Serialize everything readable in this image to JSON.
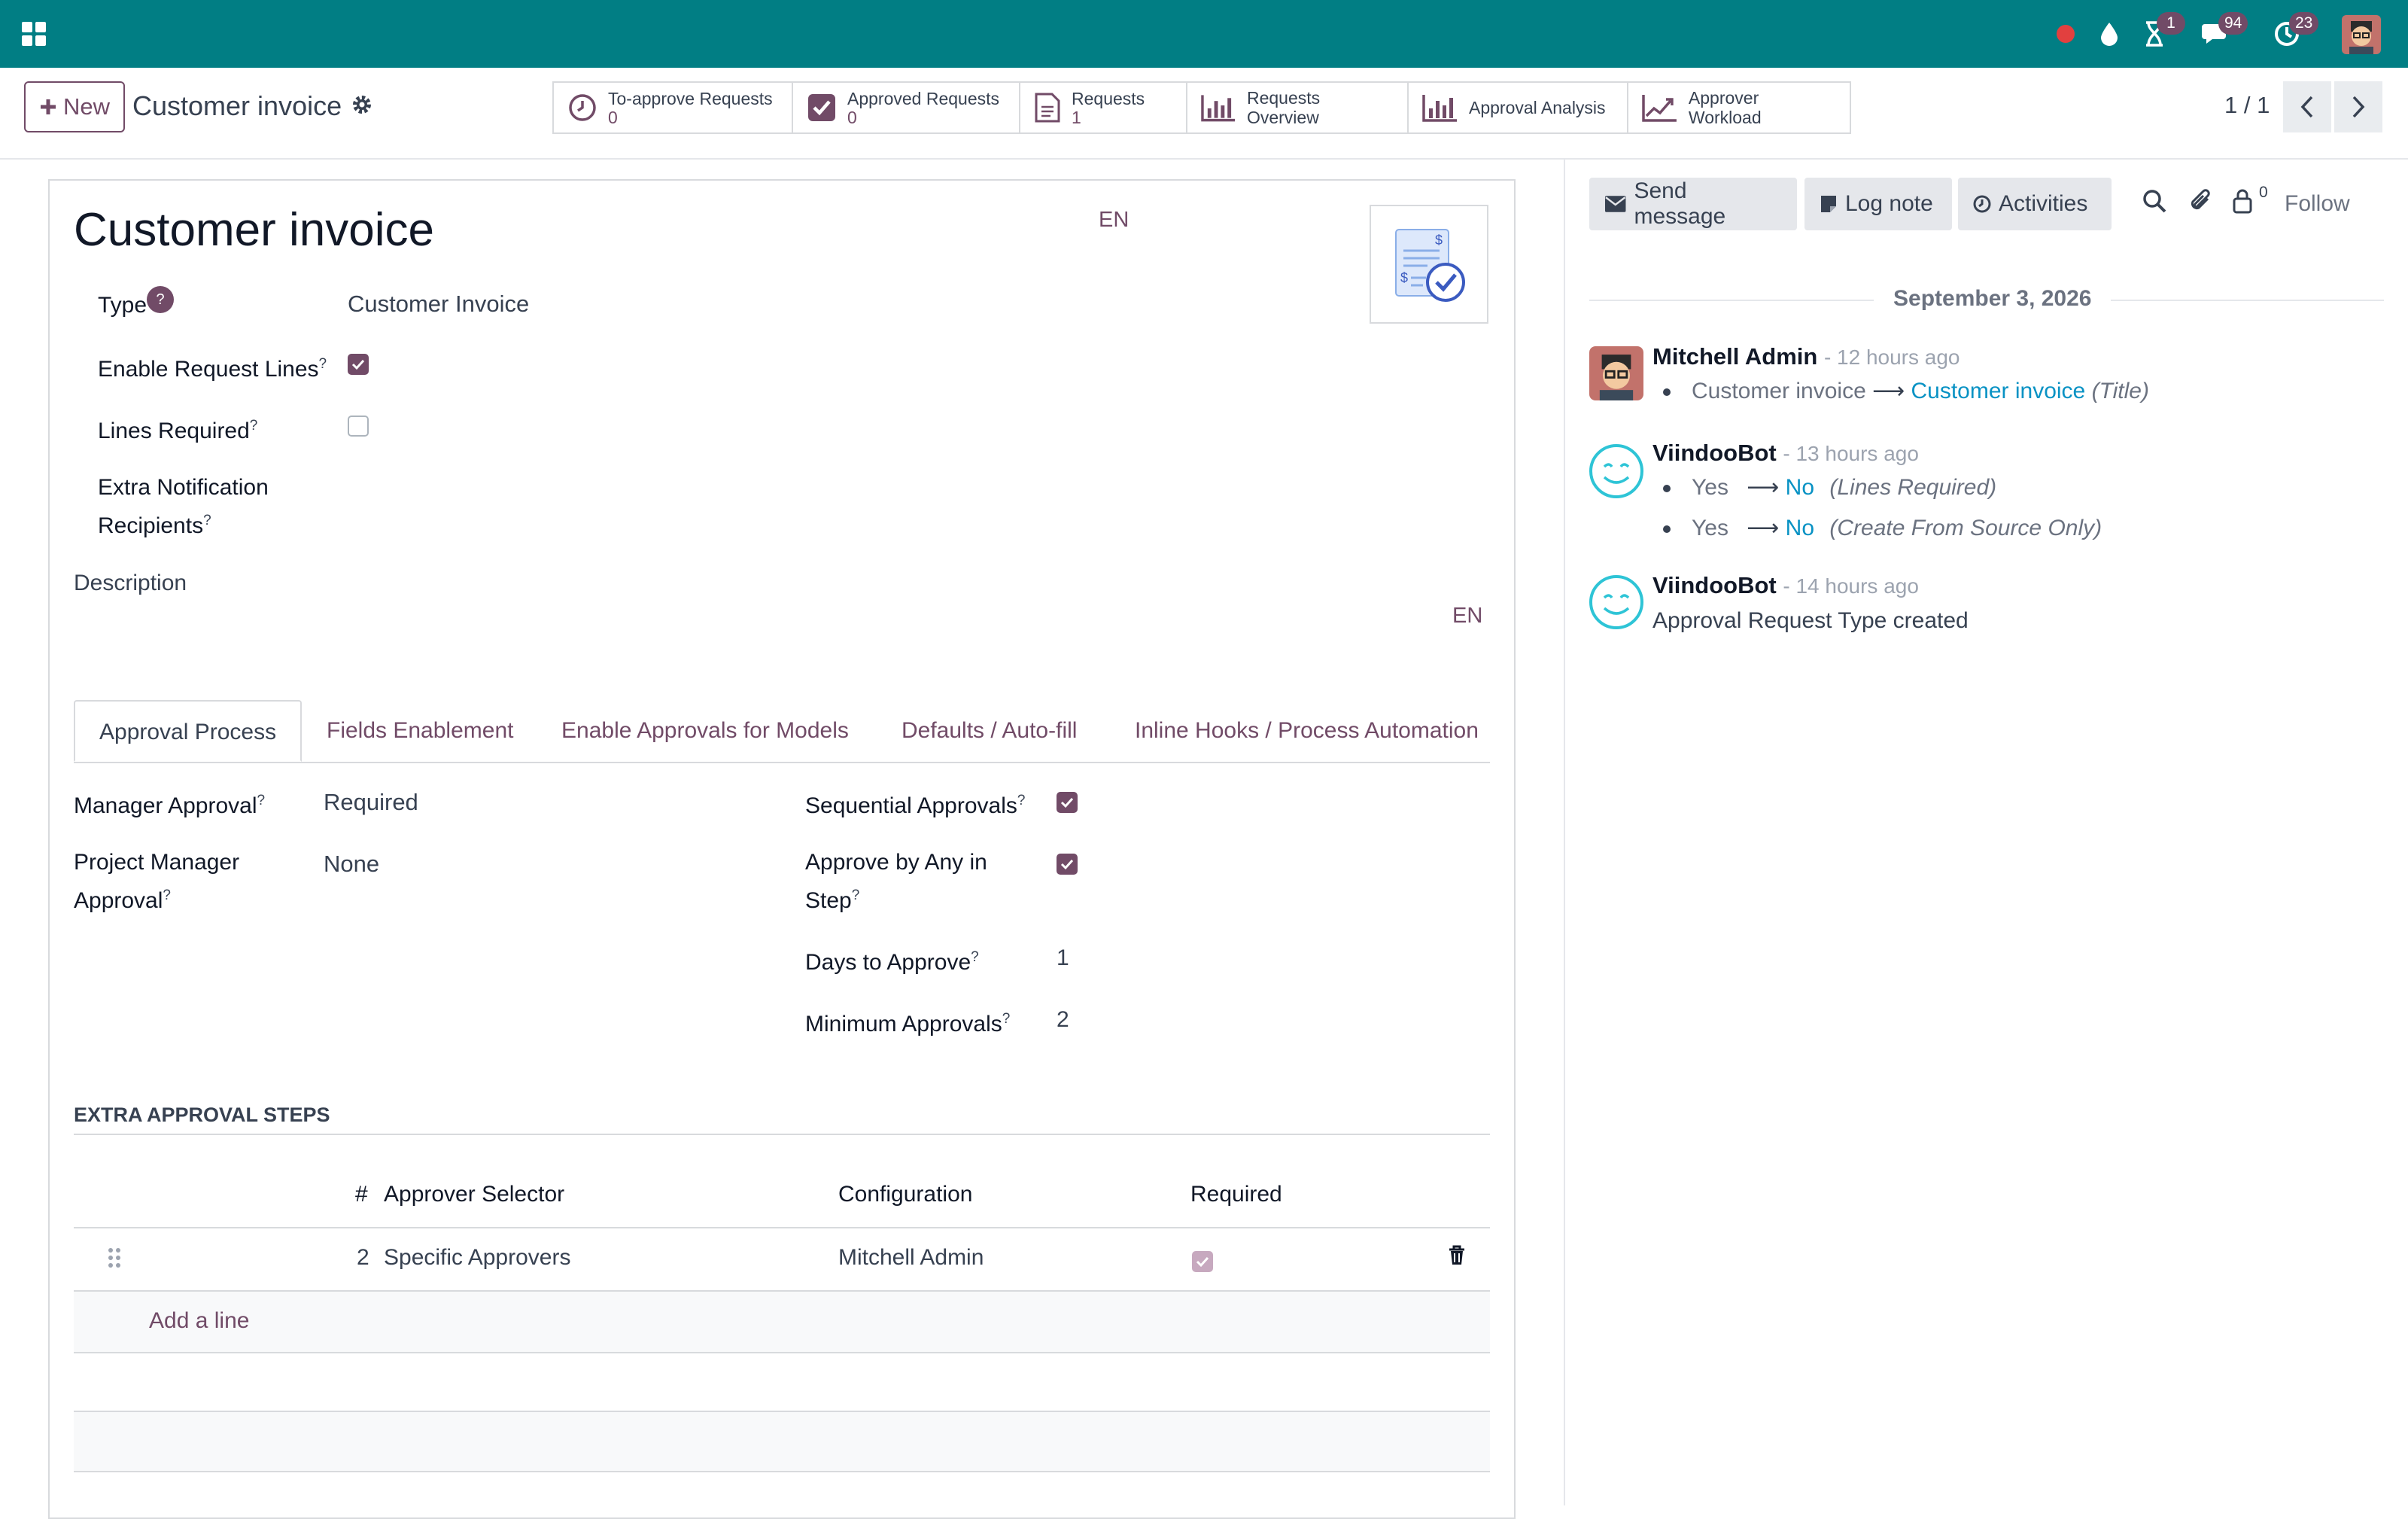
{
  "navbar": {
    "notifications": {
      "activity_count": "1",
      "messages_count": "94",
      "updates_count": "23"
    }
  },
  "control": {
    "new_label": "New",
    "breadcrumb": "Customer invoice",
    "smart_buttons": [
      {
        "label": "To-approve Requests",
        "count": "0",
        "icon": "clock-icon"
      },
      {
        "label": "Approved Requests",
        "count": "0",
        "icon": "check-square-icon"
      },
      {
        "label": "Requests",
        "count": "1",
        "icon": "document-icon"
      },
      {
        "label": "Requests Overview",
        "icon": "bar-chart-icon"
      },
      {
        "label": "Approval Analysis",
        "icon": "bar-chart-icon"
      },
      {
        "label": "Approver Workload",
        "icon": "line-chart-icon"
      }
    ],
    "pager": "1 / 1"
  },
  "form": {
    "title": "Customer invoice",
    "lang_title": "EN",
    "lang_description": "EN",
    "fields": {
      "type_label": "Type",
      "type_help": "?",
      "type_value": "Customer Invoice",
      "enable_lines_label": "Enable Request Lines",
      "enable_lines_value": true,
      "lines_required_label": "Lines Required",
      "lines_required_value": false,
      "extra_notif_label_1": "Extra Notification",
      "extra_notif_label_2": "Recipients",
      "description_label": "Description"
    },
    "tabs": [
      {
        "label": "Approval Process",
        "active": true
      },
      {
        "label": "Fields Enablement"
      },
      {
        "label": "Enable Approvals for Models"
      },
      {
        "label": "Defaults / Auto-fill"
      },
      {
        "label": "Inline Hooks / Process Automation"
      }
    ],
    "approval": {
      "manager_label": "Manager Approval",
      "manager_value": "Required",
      "pm_label_1": "Project Manager",
      "pm_label_2": "Approval",
      "pm_value": "None",
      "sequential_label": "Sequential Approvals",
      "sequential_value": true,
      "any_label_1": "Approve by Any in",
      "any_label_2": "Step",
      "any_value": true,
      "days_label": "Days to Approve",
      "days_value": "1",
      "min_label": "Minimum Approvals",
      "min_value": "2"
    },
    "steps": {
      "heading": "EXTRA APPROVAL STEPS",
      "columns": [
        "#",
        "Approver Selector",
        "Configuration",
        "Required"
      ],
      "rows": [
        {
          "seq": "2",
          "selector": "Specific Approvers",
          "config": "Mitchell Admin",
          "required": true
        }
      ],
      "add_line": "Add a line"
    },
    "help_mark": "?"
  },
  "chatter": {
    "send_message": "Send message",
    "log_note": "Log note",
    "activities": "Activities",
    "followers_count": "0",
    "follow": "Follow",
    "date": "September 3, 2026",
    "messages": [
      {
        "author": "Mitchell Admin",
        "time": "- 12 hours ago",
        "old": "Customer invoice",
        "new": "Customer invoice",
        "field": "(Title)"
      },
      {
        "author": "ViindooBot",
        "time": "- 13 hours ago",
        "changes": [
          {
            "old": "Yes",
            "new": "No",
            "field": "(Lines Required)"
          },
          {
            "old": "Yes",
            "new": "No",
            "field": "(Create From Source Only)"
          }
        ]
      },
      {
        "author": "ViindooBot",
        "time": "- 14 hours ago",
        "body": "Approval Request Type created"
      }
    ]
  }
}
